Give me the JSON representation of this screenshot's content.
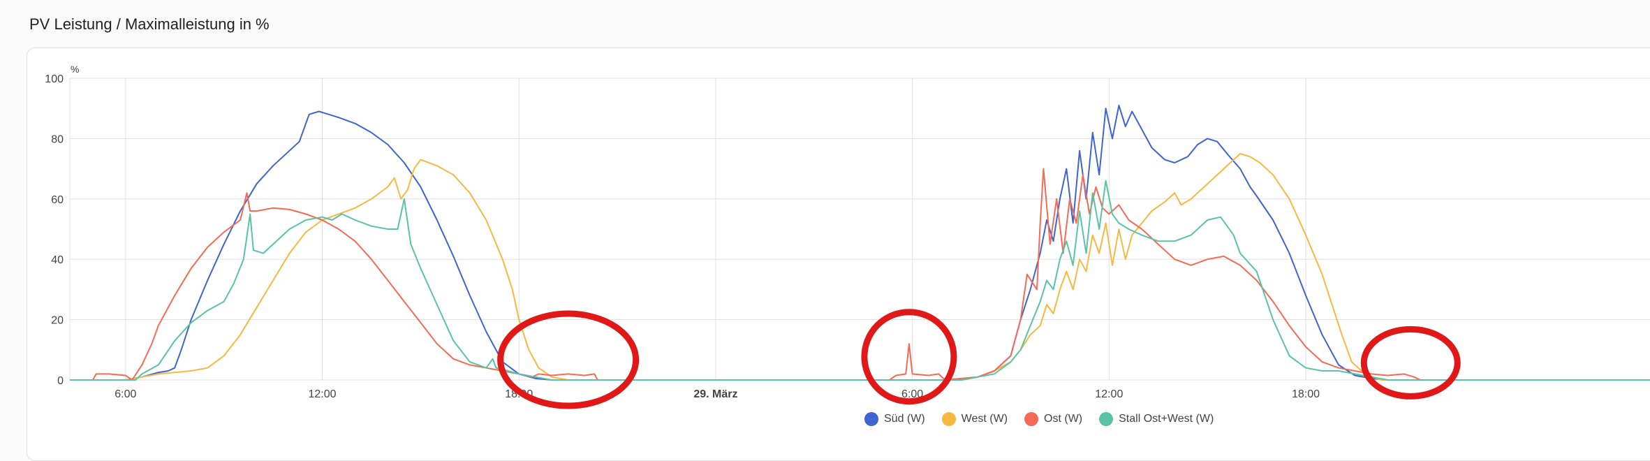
{
  "card": {
    "title": "PV Leistung / Maximalleistung in %"
  },
  "chart_data": {
    "type": "line",
    "title": "PV Leistung / Maximalleistung in %",
    "ylabel": "%",
    "ylim": [
      0,
      100
    ],
    "yticks": [
      0,
      20,
      40,
      60,
      80,
      100
    ],
    "xlim": [
      4.3,
      52.5
    ],
    "x_unit": "hours since 28 März 00:00",
    "xticks": [
      {
        "x": 6,
        "label": "6:00"
      },
      {
        "x": 12,
        "label": "12:00"
      },
      {
        "x": 18,
        "label": "18:00"
      },
      {
        "x": 24,
        "label": "29. März",
        "bold": true
      },
      {
        "x": 30,
        "label": "6:00"
      },
      {
        "x": 36,
        "label": "12:00"
      },
      {
        "x": 42,
        "label": "18:00"
      }
    ],
    "grid": true,
    "legend_position": "bottom-center",
    "series": [
      {
        "name": "Süd (W)",
        "color": "#3e63d2",
        "points": [
          [
            4.3,
            0
          ],
          [
            6,
            0
          ],
          [
            6.5,
            1
          ],
          [
            7,
            2.5
          ],
          [
            7.3,
            3
          ],
          [
            7.5,
            4
          ],
          [
            7.7,
            10
          ],
          [
            8,
            20
          ],
          [
            8.5,
            33
          ],
          [
            9,
            45
          ],
          [
            9.5,
            56
          ],
          [
            10,
            65
          ],
          [
            10.5,
            71
          ],
          [
            11,
            76
          ],
          [
            11.3,
            79
          ],
          [
            11.6,
            88
          ],
          [
            11.9,
            89
          ],
          [
            12.2,
            88
          ],
          [
            12.5,
            87
          ],
          [
            13,
            85
          ],
          [
            13.5,
            82
          ],
          [
            14,
            78
          ],
          [
            14.5,
            72
          ],
          [
            15,
            64
          ],
          [
            15.5,
            53
          ],
          [
            16,
            41
          ],
          [
            16.5,
            28
          ],
          [
            17,
            16
          ],
          [
            17.5,
            6
          ],
          [
            18,
            2
          ],
          [
            18.5,
            0.5
          ],
          [
            19,
            0
          ],
          [
            31.5,
            0
          ],
          [
            32,
            1
          ],
          [
            32.5,
            3
          ],
          [
            33,
            8
          ],
          [
            33.3,
            20
          ],
          [
            33.6,
            30
          ],
          [
            33.9,
            42
          ],
          [
            34.1,
            53
          ],
          [
            34.3,
            46
          ],
          [
            34.5,
            60
          ],
          [
            34.7,
            70
          ],
          [
            34.9,
            52
          ],
          [
            35.1,
            76
          ],
          [
            35.3,
            60
          ],
          [
            35.5,
            82
          ],
          [
            35.7,
            68
          ],
          [
            35.9,
            90
          ],
          [
            36.1,
            80
          ],
          [
            36.3,
            91
          ],
          [
            36.5,
            84
          ],
          [
            36.7,
            89
          ],
          [
            37,
            83
          ],
          [
            37.3,
            77
          ],
          [
            37.7,
            73
          ],
          [
            38,
            72
          ],
          [
            38.4,
            74
          ],
          [
            38.7,
            78
          ],
          [
            39,
            80
          ],
          [
            39.3,
            79
          ],
          [
            39.6,
            75
          ],
          [
            40,
            70
          ],
          [
            40.3,
            64
          ],
          [
            40.5,
            61
          ],
          [
            41,
            53
          ],
          [
            41.5,
            42
          ],
          [
            42,
            28
          ],
          [
            42.5,
            15
          ],
          [
            43,
            5
          ],
          [
            43.5,
            1.5
          ],
          [
            44,
            0.5
          ],
          [
            44.5,
            0
          ],
          [
            52.5,
            0
          ]
        ]
      },
      {
        "name": "West (W)",
        "color": "#f5b941",
        "points": [
          [
            4.3,
            0
          ],
          [
            6,
            0
          ],
          [
            7,
            2
          ],
          [
            8,
            3
          ],
          [
            8.5,
            4
          ],
          [
            9,
            8
          ],
          [
            9.5,
            15
          ],
          [
            10,
            24
          ],
          [
            10.5,
            33
          ],
          [
            11,
            42
          ],
          [
            11.5,
            49
          ],
          [
            12,
            53
          ],
          [
            12.5,
            55
          ],
          [
            13,
            57
          ],
          [
            13.5,
            60
          ],
          [
            14,
            64
          ],
          [
            14.2,
            67
          ],
          [
            14.4,
            60
          ],
          [
            14.6,
            63
          ],
          [
            14.8,
            70
          ],
          [
            15,
            73
          ],
          [
            15.5,
            71
          ],
          [
            16,
            68
          ],
          [
            16.5,
            62
          ],
          [
            17,
            53
          ],
          [
            17.5,
            40
          ],
          [
            17.8,
            30
          ],
          [
            18,
            20
          ],
          [
            18.3,
            10
          ],
          [
            18.6,
            4
          ],
          [
            19,
            1
          ],
          [
            19.5,
            0
          ],
          [
            31.5,
            0
          ],
          [
            32,
            1
          ],
          [
            32.5,
            3
          ],
          [
            33,
            6
          ],
          [
            33.3,
            10
          ],
          [
            33.6,
            15
          ],
          [
            33.9,
            18
          ],
          [
            34.1,
            25
          ],
          [
            34.3,
            22
          ],
          [
            34.5,
            30
          ],
          [
            34.7,
            36
          ],
          [
            34.9,
            30
          ],
          [
            35.1,
            40
          ],
          [
            35.3,
            36
          ],
          [
            35.5,
            48
          ],
          [
            35.7,
            42
          ],
          [
            35.9,
            52
          ],
          [
            36.1,
            38
          ],
          [
            36.3,
            50
          ],
          [
            36.5,
            40
          ],
          [
            36.7,
            48
          ],
          [
            37,
            52
          ],
          [
            37.3,
            56
          ],
          [
            37.7,
            59
          ],
          [
            38,
            62
          ],
          [
            38.2,
            58
          ],
          [
            38.5,
            60
          ],
          [
            39,
            65
          ],
          [
            39.5,
            70
          ],
          [
            40,
            75
          ],
          [
            40.3,
            74
          ],
          [
            40.6,
            72
          ],
          [
            41,
            68
          ],
          [
            41.5,
            60
          ],
          [
            42,
            48
          ],
          [
            42.5,
            35
          ],
          [
            42.8,
            25
          ],
          [
            43.1,
            15
          ],
          [
            43.4,
            6
          ],
          [
            43.8,
            2
          ],
          [
            44.3,
            0
          ],
          [
            52.5,
            0
          ]
        ]
      },
      {
        "name": "Ost (W)",
        "color": "#f46a55",
        "points": [
          [
            4.3,
            0
          ],
          [
            5,
            0
          ],
          [
            5.1,
            2
          ],
          [
            5.5,
            2
          ],
          [
            6,
            1.5
          ],
          [
            6.2,
            0
          ],
          [
            6.5,
            5
          ],
          [
            6.8,
            12
          ],
          [
            7,
            18
          ],
          [
            7.5,
            28
          ],
          [
            8,
            37
          ],
          [
            8.5,
            44
          ],
          [
            9,
            49
          ],
          [
            9.5,
            53
          ],
          [
            9.7,
            62
          ],
          [
            9.8,
            56
          ],
          [
            10,
            56
          ],
          [
            10.5,
            57
          ],
          [
            11,
            56.5
          ],
          [
            11.5,
            55
          ],
          [
            12,
            53
          ],
          [
            12.5,
            50
          ],
          [
            13,
            46
          ],
          [
            13.5,
            40
          ],
          [
            14,
            33
          ],
          [
            14.5,
            26
          ],
          [
            15,
            19
          ],
          [
            15.5,
            12
          ],
          [
            16,
            7
          ],
          [
            16.5,
            5
          ],
          [
            17,
            4
          ],
          [
            17.5,
            3
          ],
          [
            18,
            2
          ],
          [
            18.4,
            1
          ],
          [
            18.6,
            2
          ],
          [
            19,
            1.5
          ],
          [
            19.5,
            2
          ],
          [
            20,
            1.5
          ],
          [
            20.3,
            2
          ],
          [
            20.4,
            0
          ],
          [
            29.3,
            0
          ],
          [
            29.5,
            1.5
          ],
          [
            29.8,
            2
          ],
          [
            29.9,
            12
          ],
          [
            30,
            2
          ],
          [
            30.5,
            1.5
          ],
          [
            30.8,
            2
          ],
          [
            31,
            0
          ],
          [
            32,
            1
          ],
          [
            32.5,
            3
          ],
          [
            33,
            8
          ],
          [
            33.3,
            20
          ],
          [
            33.5,
            35
          ],
          [
            33.8,
            30
          ],
          [
            33.9,
            52
          ],
          [
            34,
            70
          ],
          [
            34.2,
            45
          ],
          [
            34.4,
            60
          ],
          [
            34.6,
            42
          ],
          [
            34.8,
            60
          ],
          [
            35,
            52
          ],
          [
            35.2,
            68
          ],
          [
            35.4,
            55
          ],
          [
            35.6,
            64
          ],
          [
            35.8,
            57
          ],
          [
            36,
            55
          ],
          [
            36.3,
            58
          ],
          [
            36.6,
            53
          ],
          [
            37,
            50
          ],
          [
            37.5,
            45
          ],
          [
            38,
            40
          ],
          [
            38.5,
            38
          ],
          [
            39,
            40
          ],
          [
            39.5,
            41
          ],
          [
            40,
            38
          ],
          [
            40.5,
            33
          ],
          [
            41,
            26
          ],
          [
            41.5,
            18
          ],
          [
            42,
            11
          ],
          [
            42.5,
            6
          ],
          [
            43,
            4
          ],
          [
            43.5,
            3
          ],
          [
            44,
            2
          ],
          [
            44.5,
            1.5
          ],
          [
            45,
            2
          ],
          [
            45.3,
            1
          ],
          [
            45.5,
            0
          ],
          [
            52.5,
            0
          ]
        ]
      },
      {
        "name": "Stall Ost+West (W)",
        "color": "#5ac2a5",
        "points": [
          [
            4.3,
            0
          ],
          [
            6,
            0
          ],
          [
            6.3,
            0
          ],
          [
            6.5,
            2
          ],
          [
            7,
            5
          ],
          [
            7.5,
            13
          ],
          [
            8,
            19
          ],
          [
            8.5,
            23
          ],
          [
            9,
            26
          ],
          [
            9.3,
            32
          ],
          [
            9.6,
            40
          ],
          [
            9.8,
            55
          ],
          [
            9.9,
            43
          ],
          [
            10.2,
            42
          ],
          [
            10.5,
            45
          ],
          [
            11,
            50
          ],
          [
            11.5,
            53
          ],
          [
            12,
            54
          ],
          [
            12.3,
            53
          ],
          [
            12.6,
            55
          ],
          [
            13,
            53
          ],
          [
            13.5,
            51
          ],
          [
            14,
            50
          ],
          [
            14.3,
            50
          ],
          [
            14.5,
            60
          ],
          [
            14.7,
            45
          ],
          [
            15,
            37
          ],
          [
            15.5,
            25
          ],
          [
            16,
            13
          ],
          [
            16.5,
            6
          ],
          [
            17,
            4
          ],
          [
            17.2,
            7
          ],
          [
            17.3,
            4
          ],
          [
            17.5,
            3.5
          ],
          [
            18,
            2
          ],
          [
            18.5,
            1
          ],
          [
            19,
            0
          ],
          [
            31.5,
            0
          ],
          [
            32,
            1
          ],
          [
            32.5,
            2
          ],
          [
            33,
            6
          ],
          [
            33.3,
            10
          ],
          [
            33.6,
            18
          ],
          [
            33.9,
            26
          ],
          [
            34.1,
            33
          ],
          [
            34.3,
            30
          ],
          [
            34.5,
            40
          ],
          [
            34.7,
            46
          ],
          [
            34.9,
            38
          ],
          [
            35.1,
            56
          ],
          [
            35.3,
            42
          ],
          [
            35.5,
            62
          ],
          [
            35.7,
            50
          ],
          [
            35.9,
            66
          ],
          [
            36.1,
            55
          ],
          [
            36.3,
            52
          ],
          [
            36.6,
            50
          ],
          [
            37,
            48
          ],
          [
            37.5,
            46
          ],
          [
            38,
            46
          ],
          [
            38.5,
            48
          ],
          [
            39,
            53
          ],
          [
            39.4,
            54
          ],
          [
            39.8,
            48
          ],
          [
            40,
            42
          ],
          [
            40.5,
            36
          ],
          [
            41,
            20
          ],
          [
            41.5,
            8
          ],
          [
            42,
            4
          ],
          [
            42.5,
            3
          ],
          [
            43,
            3
          ],
          [
            43.5,
            2
          ],
          [
            44,
            1
          ],
          [
            44.5,
            0
          ],
          [
            52.5,
            0
          ]
        ]
      }
    ]
  },
  "annotations": [
    {
      "kind": "ellipse",
      "color": "#e01818",
      "cx_hour": 19.5,
      "cy_value": 3
    },
    {
      "kind": "ellipse",
      "color": "#e01818",
      "cx_hour": 29.9,
      "cy_value": 4
    },
    {
      "kind": "ellipse",
      "color": "#e01818",
      "cx_hour": 45.2,
      "cy_value": 2
    }
  ]
}
